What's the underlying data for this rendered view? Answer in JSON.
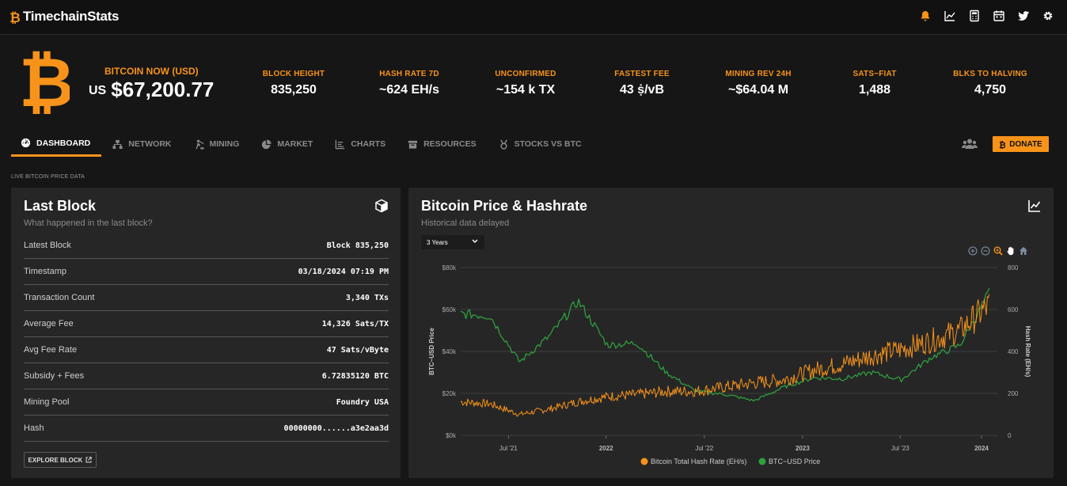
{
  "app": {
    "brand": "TimechainStats"
  },
  "topbar": {
    "icons": [
      "bell-icon",
      "line-chart-icon",
      "calculator-icon",
      "calendar-icon",
      "twitter-icon",
      "gear-icon"
    ]
  },
  "hero": {
    "btc_now_label": "BITCOIN NOW (USD)",
    "btc_currency": "US",
    "btc_price": "$67,200.77",
    "stats": [
      {
        "label": "BLOCK HEIGHT",
        "value": "835,250"
      },
      {
        "label": "HASH RATE 7D",
        "value": "~624 EH/s"
      },
      {
        "label": "UNCONFIRMED",
        "value": "~154 k TX"
      },
      {
        "label": "FASTEST FEE",
        "value": "43 ṩ/vB"
      },
      {
        "label": "MINING REV 24H",
        "value": "~$64.04 M"
      },
      {
        "label": "SATS~FIAT",
        "value": "1,488"
      },
      {
        "label": "BLKS TO HALVING",
        "value": "4,750"
      }
    ]
  },
  "nav": {
    "items": [
      {
        "label": "DASHBOARD",
        "icon": "dashboard-icon",
        "active": true
      },
      {
        "label": "NETWORK",
        "icon": "network-icon"
      },
      {
        "label": "MINING",
        "icon": "mining-icon"
      },
      {
        "label": "MARKET",
        "icon": "pie-chart-icon"
      },
      {
        "label": "CHARTS",
        "icon": "chart-icon"
      },
      {
        "label": "RESOURCES",
        "icon": "box-icon"
      },
      {
        "label": "STOCKS VS BTC",
        "icon": "medal-icon"
      }
    ],
    "donate_label": "DONATE"
  },
  "live_label": "LIVE BITCOIN PRICE DATA",
  "last_block": {
    "title": "Last Block",
    "subtitle": "What happened in the last block?",
    "rows": [
      {
        "key": "Latest Block",
        "value": "Block 835,250"
      },
      {
        "key": "Timestamp",
        "value": "03/18/2024 07:19 PM"
      },
      {
        "key": "Transaction Count",
        "value": "3,340 TXs"
      },
      {
        "key": "Average Fee",
        "value": "14,326 Sats/TX"
      },
      {
        "key": "Avg Fee Rate",
        "value": "47 Sats/vByte"
      },
      {
        "key": "Subsidy + Fees",
        "value": "6.72835120 BTC"
      },
      {
        "key": "Mining Pool",
        "value": "Foundry USA"
      },
      {
        "key": "Hash",
        "value": "00000000......a3e2aa3d"
      }
    ],
    "explore_label": "EXPLORE BLOCK"
  },
  "price_chart": {
    "title": "Bitcoin Price & Hashrate",
    "subtitle": "Historical data delayed",
    "range_selected": "3 Years"
  },
  "chart_data": {
    "type": "line",
    "x": [
      "2021-03",
      "2021-05",
      "2021-07",
      "2021-09",
      "2021-11",
      "2022-01",
      "2022-03",
      "2022-05",
      "2022-07",
      "2022-09",
      "2022-11",
      "2023-01",
      "2023-03",
      "2023-05",
      "2023-07",
      "2023-09",
      "2023-11",
      "2024-01",
      "2024-03"
    ],
    "x_ticks": [
      "Jul '21",
      "2022",
      "Jul '22",
      "2023",
      "Jul '23",
      "2024"
    ],
    "y_left_ticks": [
      "$0k",
      "$20k",
      "$40k",
      "$60k",
      "$80k"
    ],
    "y_right_ticks": [
      "0",
      "200",
      "400",
      "600",
      "800"
    ],
    "ylabel_left": "BTC~USD Price",
    "ylabel_right": "Hash Rate (EH/s)",
    "ylim_left": [
      0,
      80000
    ],
    "ylim_right": [
      0,
      800
    ],
    "legend_position": "bottom",
    "series": [
      {
        "name": "Bitcoin Total Hash Rate (EH/s)",
        "axis": "right",
        "color": "#f7931a",
        "values": [
          160,
          150,
          100,
          125,
          160,
          185,
          195,
          210,
          210,
          230,
          250,
          265,
          310,
          340,
          380,
          410,
          450,
          500,
          620
        ]
      },
      {
        "name": "BTC~USD Price",
        "axis": "left",
        "color": "#2e9e3e",
        "values": [
          58000,
          57000,
          35000,
          47000,
          64000,
          43000,
          44000,
          30000,
          21000,
          19500,
          16500,
          23000,
          27500,
          27000,
          30000,
          26500,
          37000,
          43000,
          68000
        ]
      }
    ]
  }
}
